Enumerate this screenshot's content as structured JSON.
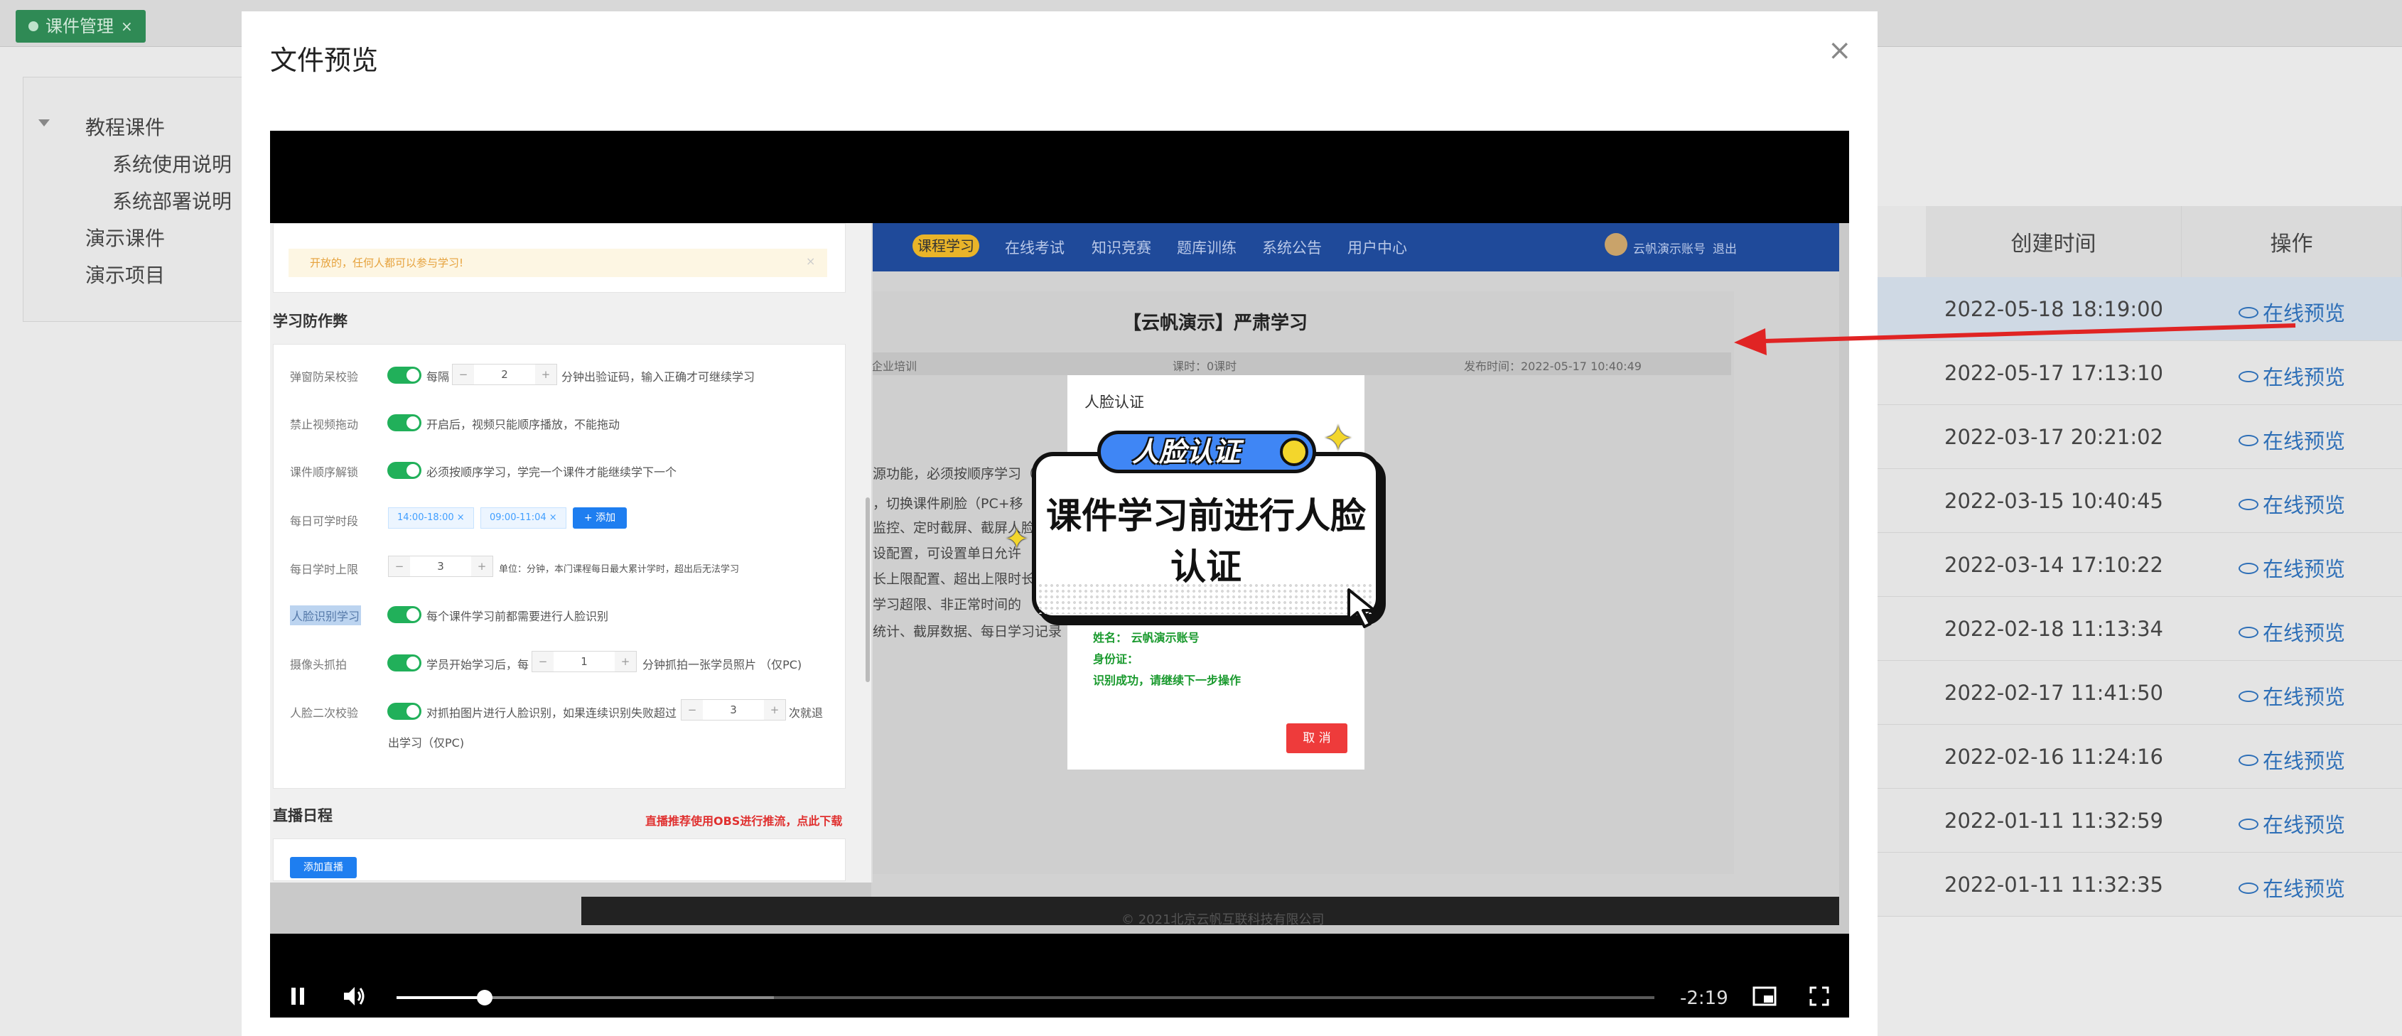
{
  "app": {
    "tab": {
      "label": "课件管理",
      "close": "×"
    },
    "tree": {
      "root": "教程课件",
      "children": [
        "系统使用说明",
        "系统部署说明"
      ],
      "siblings": [
        "演示课件",
        "演示项目"
      ]
    },
    "table": {
      "headers": {
        "created": "创建时间",
        "action": "操作"
      },
      "rows": [
        {
          "time": "2022-05-18 18:19:00",
          "action": "在线预览"
        },
        {
          "time": "2022-05-17 17:13:10",
          "action": "在线预览"
        },
        {
          "time": "2022-03-17 20:21:02",
          "action": "在线预览"
        },
        {
          "time": "2022-03-15 10:40:45",
          "action": "在线预览"
        },
        {
          "time": "2022-03-14 17:10:22",
          "action": "在线预览"
        },
        {
          "time": "2022-02-18 11:13:34",
          "action": "在线预览"
        },
        {
          "time": "2022-02-17 11:41:50",
          "action": "在线预览"
        },
        {
          "time": "2022-02-16 11:24:16",
          "action": "在线预览"
        },
        {
          "time": "2022-01-11 11:32:59",
          "action": "在线预览"
        },
        {
          "time": "2022-01-11 11:32:35",
          "action": "在线预览"
        }
      ]
    }
  },
  "modal": {
    "title": "文件预览",
    "close": "×"
  },
  "video": {
    "time_remaining": "-2:19",
    "progress_fraction": 0.07,
    "buffered_fraction": 0.3,
    "frame": {
      "nav": [
        "课程学习",
        "在线考试",
        "知识竞赛",
        "题库训练",
        "系统公告",
        "用户中心"
      ],
      "account": "云帆演示账号",
      "logout": "退出",
      "settings": {
        "notice": "开放的，任何人都可以参与学习!",
        "notice_close": "×",
        "section_title": "学习防作弊",
        "rows": [
          {
            "label": "弹窗防呆校验",
            "pre": "每隔",
            "value": "2",
            "post": "分钟出验证码，输入正确才可继续学习"
          },
          {
            "label": "禁止视频拖动",
            "text": "开启后，视频只能顺序播放，不能拖动"
          },
          {
            "label": "课件顺序解锁",
            "text": "必须按顺序学习，学完一个课件才能继续学下一个"
          },
          {
            "label": "每日可学时段",
            "tags": [
              "14:00-18:00 ×",
              "09:00-11:04 ×"
            ],
            "add": "+ 添加"
          },
          {
            "label": "每日学时上限",
            "value": "3",
            "post": "单位：分钟，本门课程每日最大累计学时，超出后无法学习"
          },
          {
            "label": "人脸识别学习",
            "text": "每个课件学习前都需要进行人脸识别"
          },
          {
            "label": "摄像头抓拍",
            "pre": "学员开始学习后，每",
            "value": "1",
            "post": "分钟抓拍一张学员照片 （仅PC)"
          },
          {
            "label": "人脸二次校验",
            "pre": "对抓拍图片进行人脸识别，如果连续识别失败超过",
            "value": "3",
            "post": "次就退",
            "post2": "出学习（仅PC)"
          }
        ],
        "live_title": "直播日程",
        "live_hint": "直播推荐使用OBS进行推流，点此下载",
        "live_add": "添加直播"
      },
      "page": {
        "title": "【云帆演示】严肃学习",
        "meta": [
          "企业培训",
          "课时：0课时",
          "发布时间：2022-05-17 10:40:49"
        ],
        "lines": [
          "源功能，必须按顺序学习（",
          "，切换课件刷脸（PC+移",
          "监控、定时截屏、截屏人脸",
          "设配置，可设置单日允许",
          "长上限配置、超出上限时长",
          "学习超限、非正常时间的",
          "统计、截屏数据、每日学习记录"
        ],
        "footer": "© 2021北京云帆互联科技有限公司"
      },
      "face_dialog": {
        "title": "人脸认证",
        "name": "姓名：  云帆演示账号",
        "id": "身份证：",
        "status": "识别成功，请继续下一步操作",
        "cancel": "取 消"
      },
      "sticker": {
        "badge": "人脸认证",
        "line1": "课件学习前进行人脸",
        "line2": "认证"
      }
    }
  },
  "colors": {
    "tab_green": "#2f8a55",
    "link_blue": "#2e6fb7",
    "switch_green": "#21b05a",
    "nav_blue": "#1f4a9a",
    "arrow_red": "#e02424",
    "cancel_red": "#ee3b3b"
  }
}
